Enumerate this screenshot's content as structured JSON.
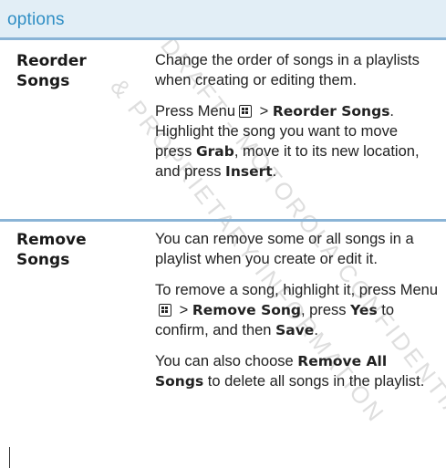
{
  "header": {
    "title": "options"
  },
  "rows": [
    {
      "term": [
        "Reorder",
        "Songs"
      ],
      "paragraphs": [
        {
          "text": "Change the order of songs in a playlists when creating or editing them."
        },
        {
          "p1": "Press Menu",
          "p2": " > ",
          "b1": "Reorder Songs",
          "p3": ". Highlight the song you want to move press ",
          "b2": "Grab",
          "p4": ", move it to its new location, and press ",
          "b3": "Insert",
          "p5": "."
        }
      ]
    },
    {
      "term": [
        "Remove",
        "Songs"
      ],
      "paragraphs": [
        {
          "text": "You can remove some or all songs in a playlist when you create or edit it."
        },
        {
          "p1": "To remove a song, highlight it, press Menu",
          "p2": " > ",
          "b1": "Remove Song",
          "p3": ", press ",
          "b2": "Yes",
          "p4": " to confirm, and then ",
          "b3": "Save",
          "p5": "."
        },
        {
          "p1": "You can also choose ",
          "b1": "Remove All Songs",
          "p2": " to delete all songs in the playlist."
        }
      ]
    }
  ],
  "watermark": {
    "line1": "DRAFT - MOTOROLA CONFIDENTIAL",
    "line2": "& PROPRIETARY INFORMATION",
    "color": "#c9c9c9"
  },
  "icons": {
    "menu_key": "menu-key-icon"
  },
  "colors": {
    "header_bg": "#e2eef6",
    "header_text": "#2f8ec4",
    "rule": "#8ab4d6"
  }
}
